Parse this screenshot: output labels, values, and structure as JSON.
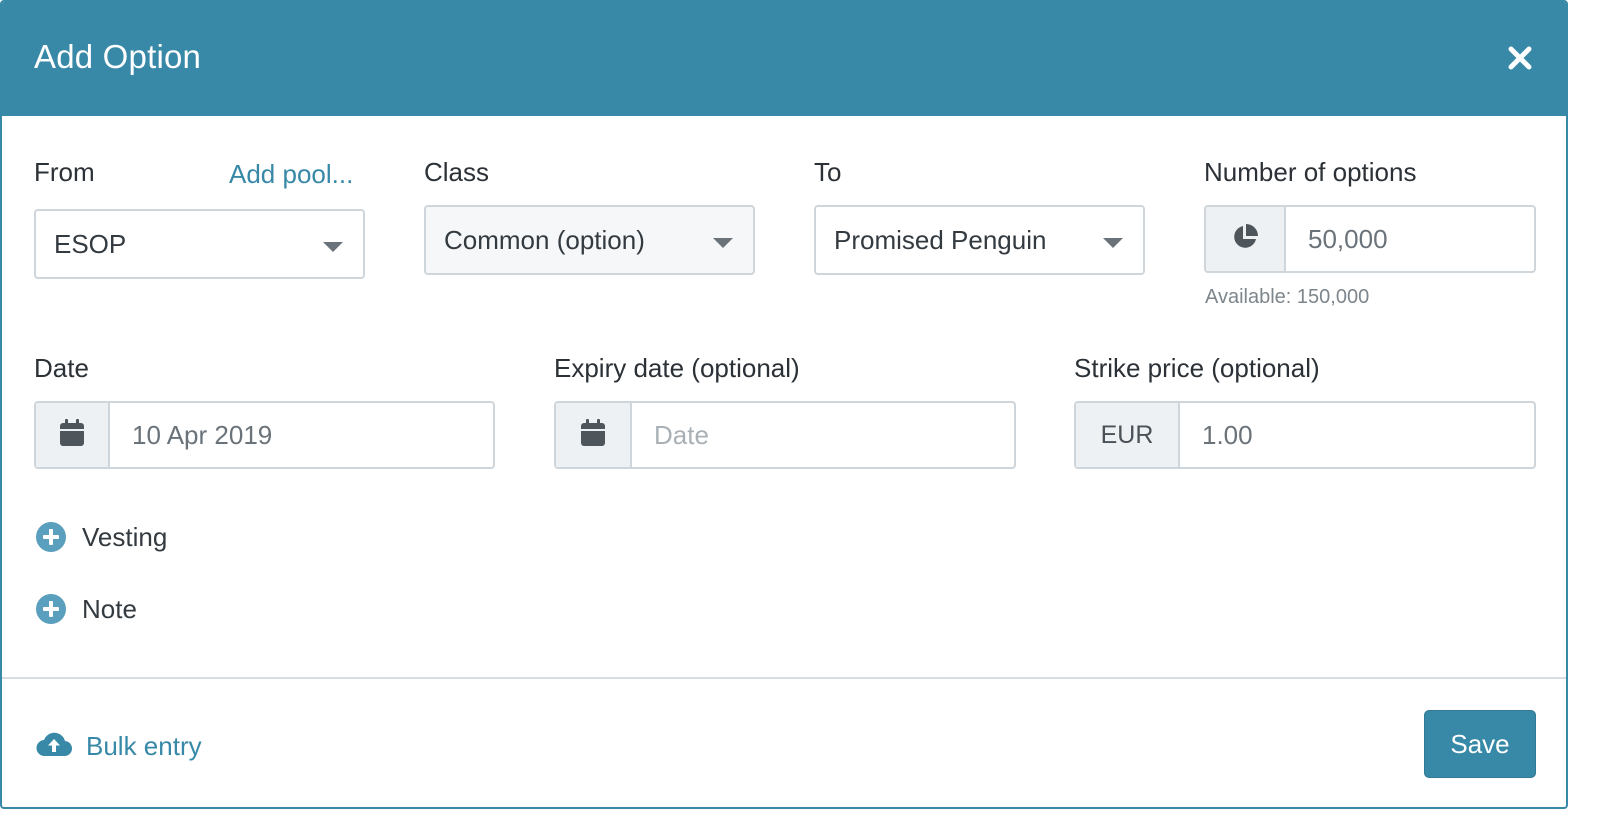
{
  "dialog": {
    "title": "Add Option",
    "close_icon": "close-icon"
  },
  "form": {
    "from": {
      "label": "From",
      "add_pool_link": "Add pool...",
      "value": "ESOP"
    },
    "class": {
      "label": "Class",
      "value": "Common (option)"
    },
    "to": {
      "label": "To",
      "value": "Promised Penguin"
    },
    "number_of_options": {
      "label": "Number of options",
      "icon": "pie-chart-icon",
      "value": "50,000",
      "help": "Available: 150,000"
    },
    "date": {
      "label": "Date",
      "icon": "calendar-icon",
      "value": "10 Apr 2019"
    },
    "expiry_date": {
      "label": "Expiry date (optional)",
      "icon": "calendar-icon",
      "placeholder": "Date"
    },
    "strike_price": {
      "label": "Strike price (optional)",
      "currency": "EUR",
      "value": "1.00"
    },
    "vesting": {
      "label": "Vesting",
      "icon": "plus-circle-icon"
    },
    "note": {
      "label": "Note",
      "icon": "plus-circle-icon"
    }
  },
  "footer": {
    "bulk_entry": {
      "label": "Bulk entry",
      "icon": "cloud-upload-icon"
    },
    "save_label": "Save"
  },
  "colors": {
    "primary": "#3789a7",
    "border": "#cfd6db",
    "addon_bg": "#eef1f3"
  }
}
